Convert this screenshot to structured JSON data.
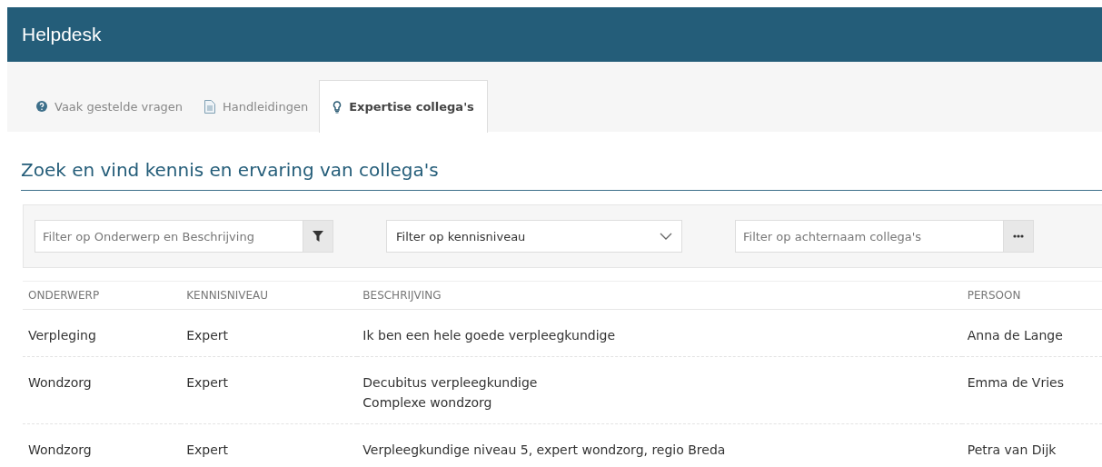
{
  "header": {
    "title": "Helpdesk"
  },
  "tabs": [
    {
      "label": "Vaak gestelde vragen",
      "selected": false
    },
    {
      "label": "Handleidingen",
      "selected": false
    },
    {
      "label": "Expertise collega's",
      "selected": true
    }
  ],
  "heading": "Zoek en vind kennis en ervaring van collega's",
  "filters": [
    {
      "kind": "text",
      "placeholder": "Filter op Onderwerp en Beschrijving"
    },
    {
      "kind": "select",
      "value": "Filter op kennisniveau"
    },
    {
      "kind": "text",
      "placeholder": "Filter op achternaam collega's"
    }
  ],
  "table": {
    "columns": [
      "ONDERWERP",
      "KENNISNIVEAU",
      "BESCHRIJVING",
      "PERSOON"
    ],
    "rows": [
      [
        "Verpleging",
        "Expert",
        "Ik ben een hele goede verpleegkundige",
        "Anna de Lange"
      ],
      [
        "Wondzorg",
        "Expert",
        "Decubitus verpleegkundige\nComplexe wondzorg",
        "Emma de Vries"
      ],
      [
        "Wondzorg",
        "Expert",
        "Verpleegkundige niveau 5, expert wondzorg, regio Breda",
        "Petra van Dijk"
      ]
    ]
  }
}
